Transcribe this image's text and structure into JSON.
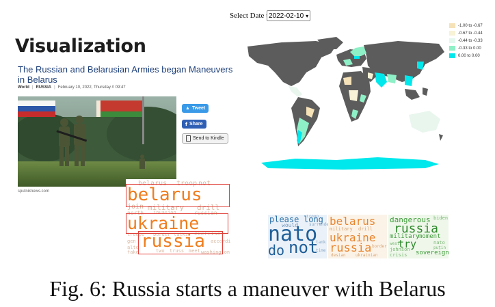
{
  "date_selector": {
    "label": "Select Date to view:",
    "value": "2022-02-10"
  },
  "heading": "Visualization",
  "article": {
    "title": "The Russian and Belarusian Armies began Maneuvers in Belarus",
    "category": "World",
    "tag": "RUSSIA",
    "date": "February 10, 2022, Thursday // 09:47",
    "photo_credit": "sputniknews.com"
  },
  "share_buttons": {
    "tweet": "Tweet",
    "share": "Share",
    "kindle": "Send to Kindle"
  },
  "legend": [
    {
      "label": "-1.00 to -0.67",
      "color": "#f6e2b8"
    },
    {
      "label": "-0.67 to -0.44",
      "color": "#f8f2d6"
    },
    {
      "label": "-0.44 to -0.33",
      "color": "#e4f8ef"
    },
    {
      "label": "-0.33 to 0.00",
      "color": "#8ef0c6"
    },
    {
      "label": "0.00 to 0.00",
      "color": "#00e8ec"
    }
  ],
  "map_colors": {
    "no_data": "#5c5c5c",
    "sea": "#ffffff"
  },
  "cloud_left": {
    "big_words": [
      "belarus",
      "ukraine",
      "russia"
    ],
    "small_words": [
      "belarus",
      "troop",
      "not",
      "join",
      "military",
      "drill",
      "north",
      "invasion",
      "russian",
      "troops",
      "border",
      "talks",
      "exercise",
      "fake",
      "according",
      "washington",
      "two",
      "truss",
      "meet",
      "alto",
      "gen"
    ]
  },
  "cloud_right": {
    "blue_words": [
      "please",
      "long",
      "would",
      "nato",
      "do",
      "not",
      "troop",
      "surrender",
      "tank",
      "time"
    ],
    "orange_words": [
      "belarus",
      "ukraine",
      "russia",
      "military",
      "drill",
      "border",
      "desian",
      "ukrainian"
    ],
    "green_words": [
      "dangerous",
      "biden",
      "russia",
      "military",
      "moment",
      "try",
      "nato",
      "johnson",
      "crisis",
      "sovereign",
      "putin",
      "west"
    ]
  },
  "caption": "Fig. 6: Russia starts a maneuver with Belarus"
}
